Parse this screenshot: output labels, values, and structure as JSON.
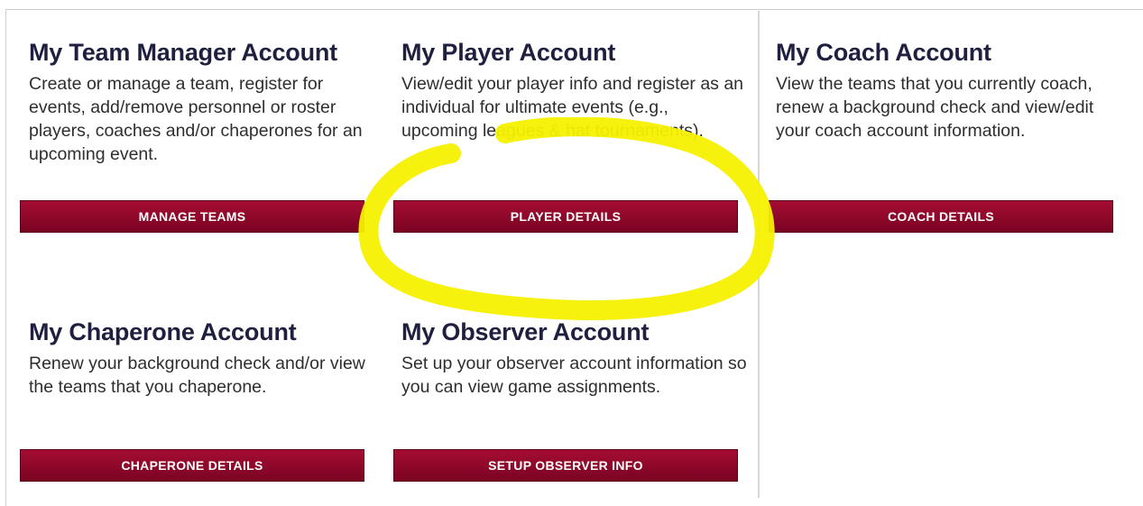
{
  "cards": {
    "team_manager": {
      "title": "My Team Manager Account",
      "description": "Create or manage a team, register for events, add/remove personnel or roster players, coaches and/or chaperones for an upcoming event.",
      "button": "MANAGE TEAMS"
    },
    "player": {
      "title": "My Player Account",
      "description": "View/edit your player info and register as an individual for ultimate events (e.g., upcoming leagues & hat tournaments).",
      "button": "PLAYER DETAILS"
    },
    "coach": {
      "title": "My Coach Account",
      "description": "View the teams that you currently coach, renew a background check and view/edit your coach account information.",
      "button": "COACH DETAILS"
    },
    "chaperone": {
      "title": "My Chaperone Account",
      "description": "Renew your background check and/or view the teams that you chaperone.",
      "button": "CHAPERONE DETAILS"
    },
    "observer": {
      "title": "My Observer Account",
      "description": "Set up your observer account information so you can view game assignments.",
      "button": "SETUP OBSERVER INFO"
    }
  },
  "colors": {
    "button_top": "#a50d33",
    "button_bottom": "#7a0322",
    "title": "#1f1f3f",
    "highlight": "#f5f000"
  }
}
